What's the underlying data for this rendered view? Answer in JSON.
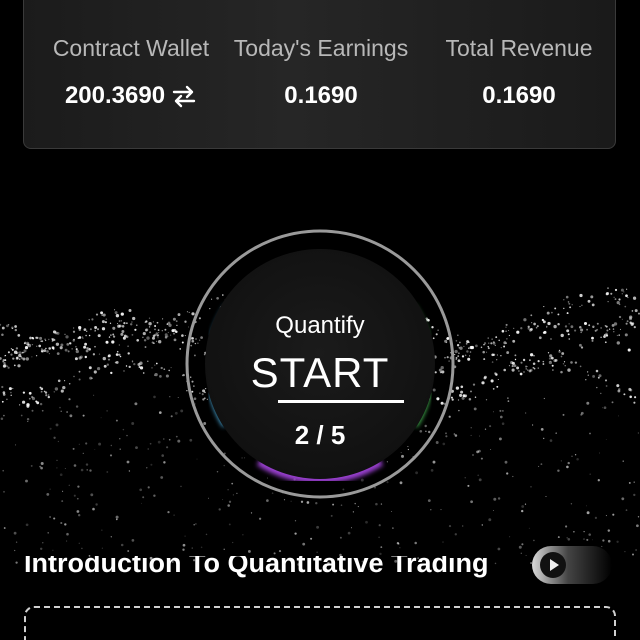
{
  "stats": {
    "contract_wallet": {
      "label": "Contract Wallet",
      "value": "200.3690"
    },
    "todays_earnings": {
      "label": "Today's Earnings",
      "value": "0.1690"
    },
    "total_revenue": {
      "label": "Total Revenue",
      "value": "0.1690"
    }
  },
  "quantify": {
    "title": "Quantify",
    "action": "START",
    "progress": "2 / 5"
  },
  "intro": {
    "title": "Introduction To Quantitative Trading"
  },
  "colors": {
    "background": "#000000",
    "ring_top": "#c8844a",
    "ring_right": "#4cc85a",
    "ring_bottom": "#9a3fd0",
    "ring_left": "#4aa8d8"
  },
  "icons": {
    "swap": "swap-arrows-icon",
    "play": "play-icon"
  }
}
